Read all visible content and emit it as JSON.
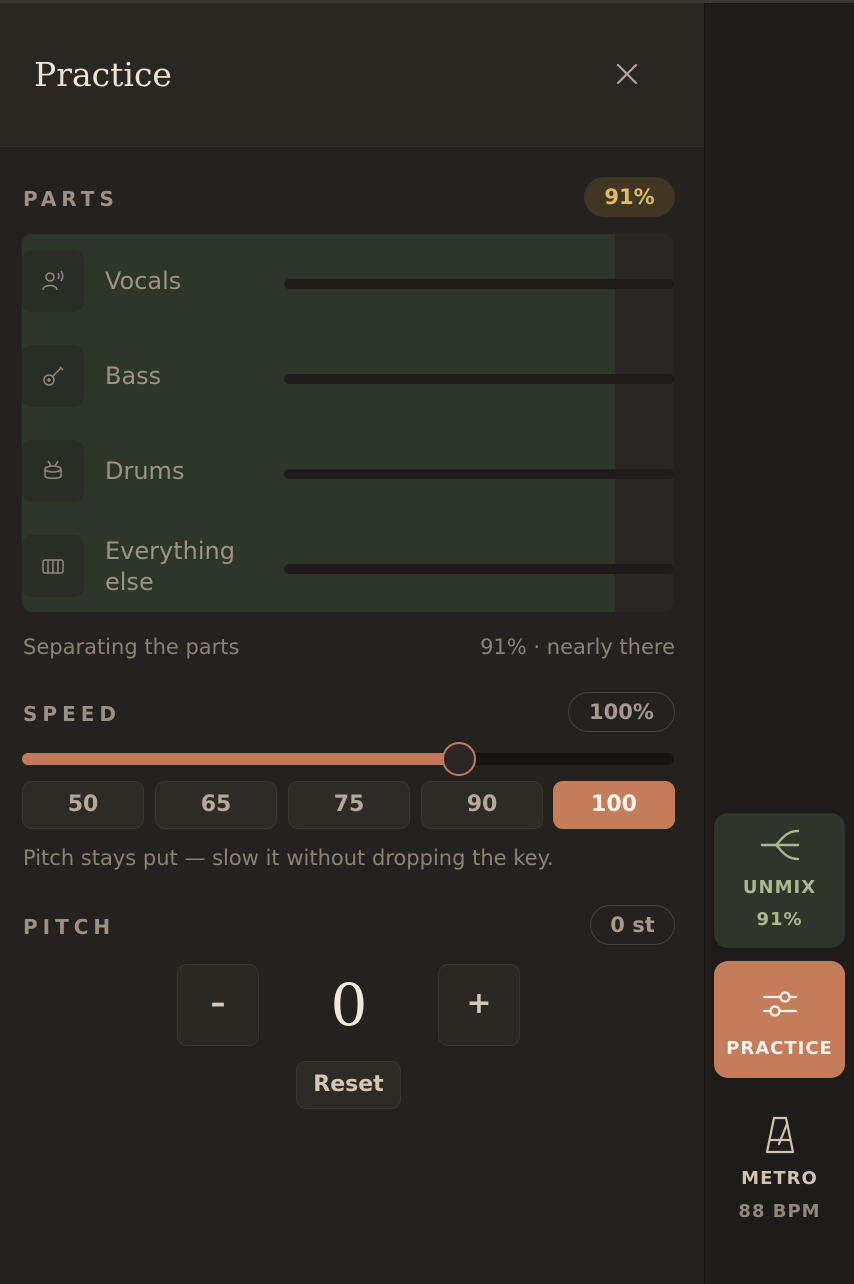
{
  "panel": {
    "title": "Practice"
  },
  "parts": {
    "label": "PARTS",
    "percent_label": "91%",
    "progress": 0.91,
    "items": [
      {
        "label": "Vocals",
        "icon": "vocals-icon"
      },
      {
        "label": "Bass",
        "icon": "bass-guitar-icon"
      },
      {
        "label": "Drums",
        "icon": "drum-icon"
      },
      {
        "label": "Everything else",
        "icon": "keys-icon"
      }
    ],
    "status_left": "Separating the parts",
    "status_right": "91% · nearly there"
  },
  "speed": {
    "label": "SPEED",
    "value_label": "100%",
    "slider_fraction": 0.67,
    "presets": [
      "50",
      "65",
      "75",
      "90",
      "100"
    ],
    "active_preset": "100",
    "hint": "Pitch stays put — slow it without dropping the key."
  },
  "pitch": {
    "label": "PITCH",
    "value_label": "0 st",
    "minus": "–",
    "plus": "+",
    "value": "0",
    "reset": "Reset"
  },
  "rail": {
    "unmix": {
      "label": "UNMIX",
      "sub": "91%",
      "icon": "split-icon"
    },
    "practice": {
      "label": "PRACTICE",
      "icon": "sliders-icon"
    },
    "metro": {
      "label": "METRO",
      "sub": "88 BPM",
      "icon": "metronome-icon"
    }
  },
  "colors": {
    "accent": "#c57c5b",
    "gold": "#e2b965",
    "unmix_green": "#aab98f"
  }
}
